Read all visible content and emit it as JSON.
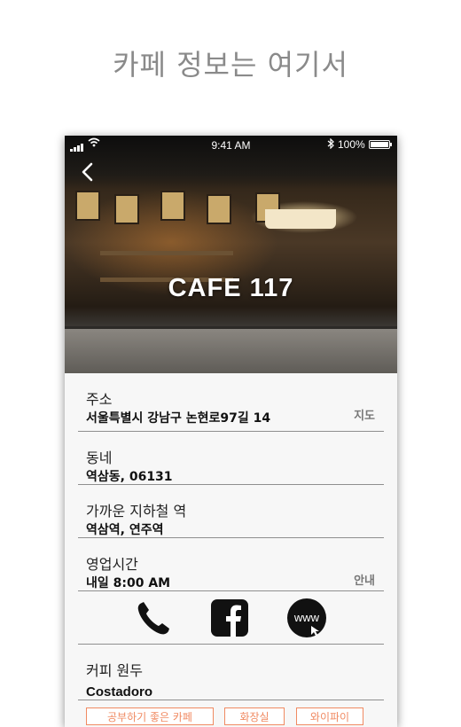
{
  "headline": "카페 정보는 여기서",
  "status_bar": {
    "time": "9:41 AM",
    "battery": "100%"
  },
  "cafe_name": "CAFE 117",
  "info": {
    "address": {
      "label": "주소",
      "value": "서울특별시 강남구 논현로97길 14",
      "action": "지도"
    },
    "neighborhood": {
      "label": "동네",
      "value": "역삼동, 06131"
    },
    "subway": {
      "label": "가까운 지하철 역",
      "value": "역삼역, 연주역"
    },
    "hours": {
      "label": "영업시간",
      "value": "내일 8:00 AM",
      "action": "안내"
    },
    "coffee": {
      "label": "커피 원두",
      "value": "Costadoro"
    }
  },
  "icons": {
    "phone": "phone-icon",
    "facebook": "facebook-icon",
    "website": "www-icon",
    "website_text": "www"
  },
  "tags": [
    "공부하기 좋은 카페",
    "화장실",
    "와이파이"
  ]
}
